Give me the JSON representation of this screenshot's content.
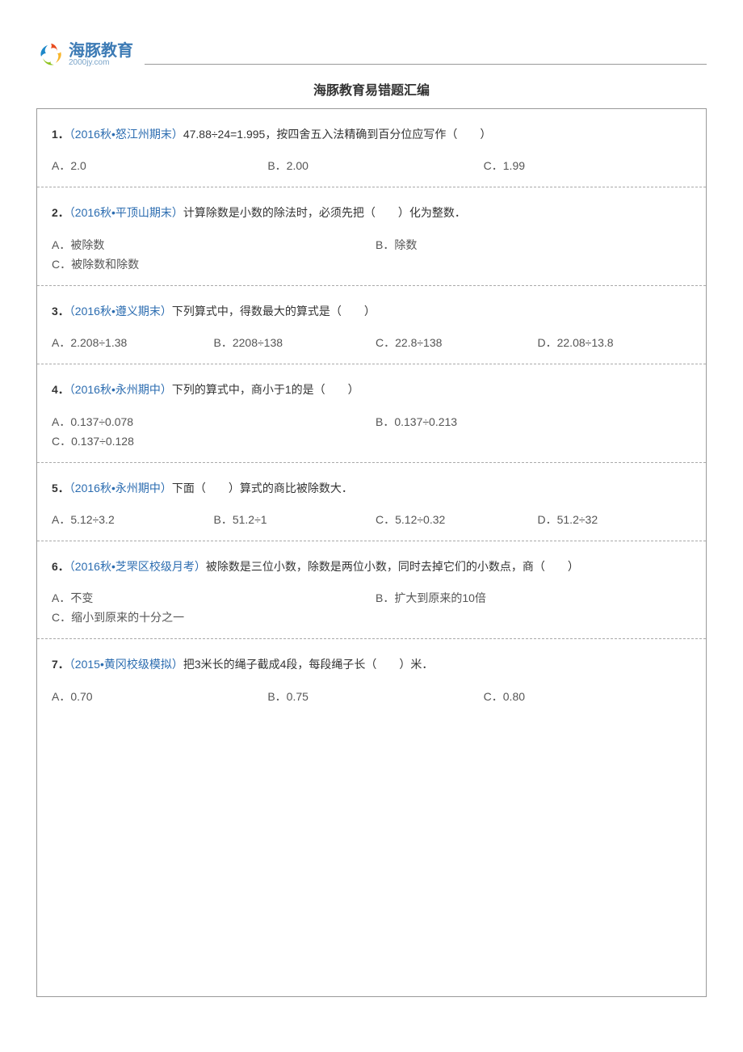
{
  "logo": {
    "main": "海豚教育",
    "sub": "2000jy.com"
  },
  "title": "海豚教育易错题汇编",
  "questions": [
    {
      "num": "1．",
      "source": "（2016秋•怒江州期末）",
      "text": "47.88÷24=1.995，按四舍五入法精确到百分位应写作（　　）",
      "layout": "3",
      "options": [
        "A．2.0",
        "B．2.00",
        "C．1.99"
      ]
    },
    {
      "num": "2．",
      "source": "（2016秋•平顶山期末）",
      "text": "计算除数是小数的除法时，必须先把（　　）化为整数．",
      "layout": "2",
      "options": [
        "A．被除数",
        "B．除数",
        "C．被除数和除数"
      ]
    },
    {
      "num": "3．",
      "source": "（2016秋•遵义期末）",
      "text": "下列算式中，得数最大的算式是（　　）",
      "layout": "4",
      "options": [
        "A．2.208÷1.38",
        "B．2208÷138",
        "C．22.8÷138",
        "D．22.08÷13.8"
      ]
    },
    {
      "num": "4．",
      "source": "（2016秋•永州期中）",
      "text": "下列的算式中，商小于1的是（　　）",
      "layout": "2",
      "options": [
        "A．0.137÷0.078",
        "B．0.137÷0.213",
        "C．0.137÷0.128"
      ]
    },
    {
      "num": "5．",
      "source": "（2016秋•永州期中）",
      "text": "下面（　　）算式的商比被除数大．",
      "layout": "4",
      "options": [
        "A．5.12÷3.2",
        "B．51.2÷1",
        "C．5.12÷0.32",
        "D．51.2÷32"
      ]
    },
    {
      "num": "6．",
      "source": "（2016秋•芝罘区校级月考）",
      "text": "被除数是三位小数，除数是两位小数，同时去掉它们的小数点，商（　　）",
      "layout": "2",
      "options": [
        "A．不变",
        "B．扩大到原来的10倍",
        "C．缩小到原来的十分之一"
      ]
    },
    {
      "num": "7．",
      "source": "（2015•黄冈校级模拟）",
      "text": "把3米长的绳子截成4段，每段绳子长（　　）米．",
      "layout": "3",
      "options": [
        "A．0.70",
        "B．0.75",
        "C．0.80"
      ]
    }
  ]
}
